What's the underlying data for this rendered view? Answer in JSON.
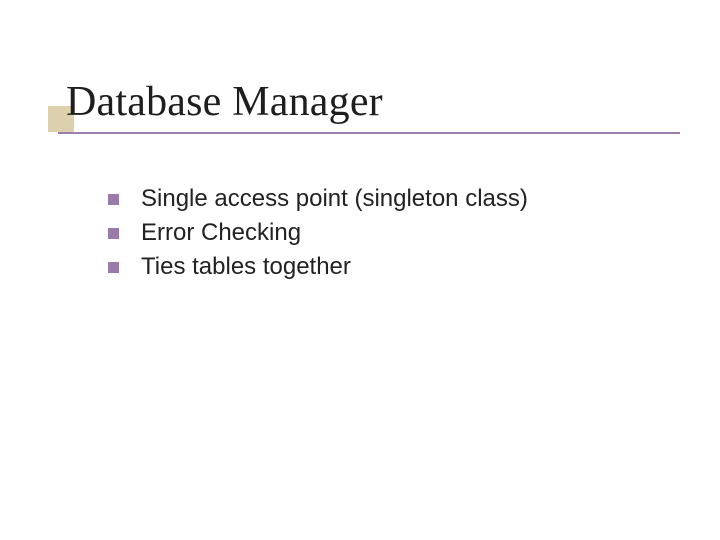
{
  "slide": {
    "title": "Database Manager",
    "bullets": [
      "Single access point (singleton class)",
      "Error Checking",
      "Ties tables together"
    ]
  }
}
